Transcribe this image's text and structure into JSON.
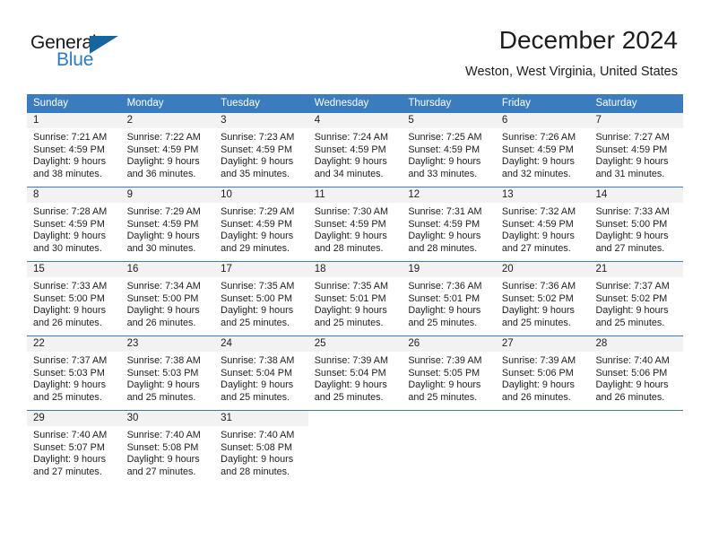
{
  "brand": {
    "name_part1": "General",
    "name_part2": "Blue",
    "logo_icon": "blue-triangle-icon",
    "accent_color": "#15669e",
    "text_color": "#2b7cc4"
  },
  "header": {
    "title": "December 2024",
    "subtitle": "Weston, West Virginia, United States"
  },
  "calendar": {
    "header_bg_color": "#3a7cbd",
    "day_band_color": "#f2f2f2",
    "weekdays": [
      "Sunday",
      "Monday",
      "Tuesday",
      "Wednesday",
      "Thursday",
      "Friday",
      "Saturday"
    ],
    "weeks": [
      [
        {
          "day": "1",
          "sunrise": "Sunrise: 7:21 AM",
          "sunset": "Sunset: 4:59 PM",
          "daylight_line1": "Daylight: 9 hours",
          "daylight_line2": "and 38 minutes."
        },
        {
          "day": "2",
          "sunrise": "Sunrise: 7:22 AM",
          "sunset": "Sunset: 4:59 PM",
          "daylight_line1": "Daylight: 9 hours",
          "daylight_line2": "and 36 minutes."
        },
        {
          "day": "3",
          "sunrise": "Sunrise: 7:23 AM",
          "sunset": "Sunset: 4:59 PM",
          "daylight_line1": "Daylight: 9 hours",
          "daylight_line2": "and 35 minutes."
        },
        {
          "day": "4",
          "sunrise": "Sunrise: 7:24 AM",
          "sunset": "Sunset: 4:59 PM",
          "daylight_line1": "Daylight: 9 hours",
          "daylight_line2": "and 34 minutes."
        },
        {
          "day": "5",
          "sunrise": "Sunrise: 7:25 AM",
          "sunset": "Sunset: 4:59 PM",
          "daylight_line1": "Daylight: 9 hours",
          "daylight_line2": "and 33 minutes."
        },
        {
          "day": "6",
          "sunrise": "Sunrise: 7:26 AM",
          "sunset": "Sunset: 4:59 PM",
          "daylight_line1": "Daylight: 9 hours",
          "daylight_line2": "and 32 minutes."
        },
        {
          "day": "7",
          "sunrise": "Sunrise: 7:27 AM",
          "sunset": "Sunset: 4:59 PM",
          "daylight_line1": "Daylight: 9 hours",
          "daylight_line2": "and 31 minutes."
        }
      ],
      [
        {
          "day": "8",
          "sunrise": "Sunrise: 7:28 AM",
          "sunset": "Sunset: 4:59 PM",
          "daylight_line1": "Daylight: 9 hours",
          "daylight_line2": "and 30 minutes."
        },
        {
          "day": "9",
          "sunrise": "Sunrise: 7:29 AM",
          "sunset": "Sunset: 4:59 PM",
          "daylight_line1": "Daylight: 9 hours",
          "daylight_line2": "and 30 minutes."
        },
        {
          "day": "10",
          "sunrise": "Sunrise: 7:29 AM",
          "sunset": "Sunset: 4:59 PM",
          "daylight_line1": "Daylight: 9 hours",
          "daylight_line2": "and 29 minutes."
        },
        {
          "day": "11",
          "sunrise": "Sunrise: 7:30 AM",
          "sunset": "Sunset: 4:59 PM",
          "daylight_line1": "Daylight: 9 hours",
          "daylight_line2": "and 28 minutes."
        },
        {
          "day": "12",
          "sunrise": "Sunrise: 7:31 AM",
          "sunset": "Sunset: 4:59 PM",
          "daylight_line1": "Daylight: 9 hours",
          "daylight_line2": "and 28 minutes."
        },
        {
          "day": "13",
          "sunrise": "Sunrise: 7:32 AM",
          "sunset": "Sunset: 4:59 PM",
          "daylight_line1": "Daylight: 9 hours",
          "daylight_line2": "and 27 minutes."
        },
        {
          "day": "14",
          "sunrise": "Sunrise: 7:33 AM",
          "sunset": "Sunset: 5:00 PM",
          "daylight_line1": "Daylight: 9 hours",
          "daylight_line2": "and 27 minutes."
        }
      ],
      [
        {
          "day": "15",
          "sunrise": "Sunrise: 7:33 AM",
          "sunset": "Sunset: 5:00 PM",
          "daylight_line1": "Daylight: 9 hours",
          "daylight_line2": "and 26 minutes."
        },
        {
          "day": "16",
          "sunrise": "Sunrise: 7:34 AM",
          "sunset": "Sunset: 5:00 PM",
          "daylight_line1": "Daylight: 9 hours",
          "daylight_line2": "and 26 minutes."
        },
        {
          "day": "17",
          "sunrise": "Sunrise: 7:35 AM",
          "sunset": "Sunset: 5:00 PM",
          "daylight_line1": "Daylight: 9 hours",
          "daylight_line2": "and 25 minutes."
        },
        {
          "day": "18",
          "sunrise": "Sunrise: 7:35 AM",
          "sunset": "Sunset: 5:01 PM",
          "daylight_line1": "Daylight: 9 hours",
          "daylight_line2": "and 25 minutes."
        },
        {
          "day": "19",
          "sunrise": "Sunrise: 7:36 AM",
          "sunset": "Sunset: 5:01 PM",
          "daylight_line1": "Daylight: 9 hours",
          "daylight_line2": "and 25 minutes."
        },
        {
          "day": "20",
          "sunrise": "Sunrise: 7:36 AM",
          "sunset": "Sunset: 5:02 PM",
          "daylight_line1": "Daylight: 9 hours",
          "daylight_line2": "and 25 minutes."
        },
        {
          "day": "21",
          "sunrise": "Sunrise: 7:37 AM",
          "sunset": "Sunset: 5:02 PM",
          "daylight_line1": "Daylight: 9 hours",
          "daylight_line2": "and 25 minutes."
        }
      ],
      [
        {
          "day": "22",
          "sunrise": "Sunrise: 7:37 AM",
          "sunset": "Sunset: 5:03 PM",
          "daylight_line1": "Daylight: 9 hours",
          "daylight_line2": "and 25 minutes."
        },
        {
          "day": "23",
          "sunrise": "Sunrise: 7:38 AM",
          "sunset": "Sunset: 5:03 PM",
          "daylight_line1": "Daylight: 9 hours",
          "daylight_line2": "and 25 minutes."
        },
        {
          "day": "24",
          "sunrise": "Sunrise: 7:38 AM",
          "sunset": "Sunset: 5:04 PM",
          "daylight_line1": "Daylight: 9 hours",
          "daylight_line2": "and 25 minutes."
        },
        {
          "day": "25",
          "sunrise": "Sunrise: 7:39 AM",
          "sunset": "Sunset: 5:04 PM",
          "daylight_line1": "Daylight: 9 hours",
          "daylight_line2": "and 25 minutes."
        },
        {
          "day": "26",
          "sunrise": "Sunrise: 7:39 AM",
          "sunset": "Sunset: 5:05 PM",
          "daylight_line1": "Daylight: 9 hours",
          "daylight_line2": "and 25 minutes."
        },
        {
          "day": "27",
          "sunrise": "Sunrise: 7:39 AM",
          "sunset": "Sunset: 5:06 PM",
          "daylight_line1": "Daylight: 9 hours",
          "daylight_line2": "and 26 minutes."
        },
        {
          "day": "28",
          "sunrise": "Sunrise: 7:40 AM",
          "sunset": "Sunset: 5:06 PM",
          "daylight_line1": "Daylight: 9 hours",
          "daylight_line2": "and 26 minutes."
        }
      ],
      [
        {
          "day": "29",
          "sunrise": "Sunrise: 7:40 AM",
          "sunset": "Sunset: 5:07 PM",
          "daylight_line1": "Daylight: 9 hours",
          "daylight_line2": "and 27 minutes."
        },
        {
          "day": "30",
          "sunrise": "Sunrise: 7:40 AM",
          "sunset": "Sunset: 5:08 PM",
          "daylight_line1": "Daylight: 9 hours",
          "daylight_line2": "and 27 minutes."
        },
        {
          "day": "31",
          "sunrise": "Sunrise: 7:40 AM",
          "sunset": "Sunset: 5:08 PM",
          "daylight_line1": "Daylight: 9 hours",
          "daylight_line2": "and 28 minutes."
        },
        {
          "day": "",
          "sunrise": "",
          "sunset": "",
          "daylight_line1": "",
          "daylight_line2": ""
        },
        {
          "day": "",
          "sunrise": "",
          "sunset": "",
          "daylight_line1": "",
          "daylight_line2": ""
        },
        {
          "day": "",
          "sunrise": "",
          "sunset": "",
          "daylight_line1": "",
          "daylight_line2": ""
        },
        {
          "day": "",
          "sunrise": "",
          "sunset": "",
          "daylight_line1": "",
          "daylight_line2": ""
        }
      ]
    ]
  }
}
